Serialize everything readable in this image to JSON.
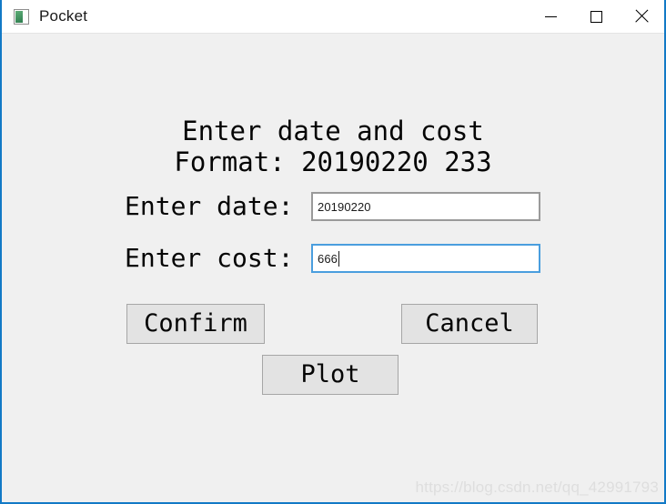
{
  "window": {
    "title": "Pocket",
    "icon": "app-icon",
    "accent_color": "#1279c6",
    "client_background": "#f0f0f0",
    "titlebar_background": "#ffffff",
    "controls": {
      "minimize_label": "─",
      "maximize_label": "☐",
      "close_label": "✕"
    }
  },
  "form": {
    "heading_line1": "Enter date and cost",
    "heading_line2": "Format: 20190220 233",
    "date": {
      "label": "Enter date:",
      "value": "20190220",
      "placeholder": "",
      "focused": false,
      "border_color": "#9a9a9a"
    },
    "cost": {
      "label": "Enter cost:",
      "value": "666",
      "placeholder": "",
      "focused": true,
      "border_color": "#4a9ede"
    }
  },
  "buttons": {
    "confirm": "Confirm",
    "cancel": "Cancel",
    "plot": "Plot",
    "face_color": "#e3e3e3",
    "border_color": "#a6a6a6"
  },
  "watermark": {
    "text": "https://blog.csdn.net/qq_42991793",
    "color": "#dedede"
  }
}
